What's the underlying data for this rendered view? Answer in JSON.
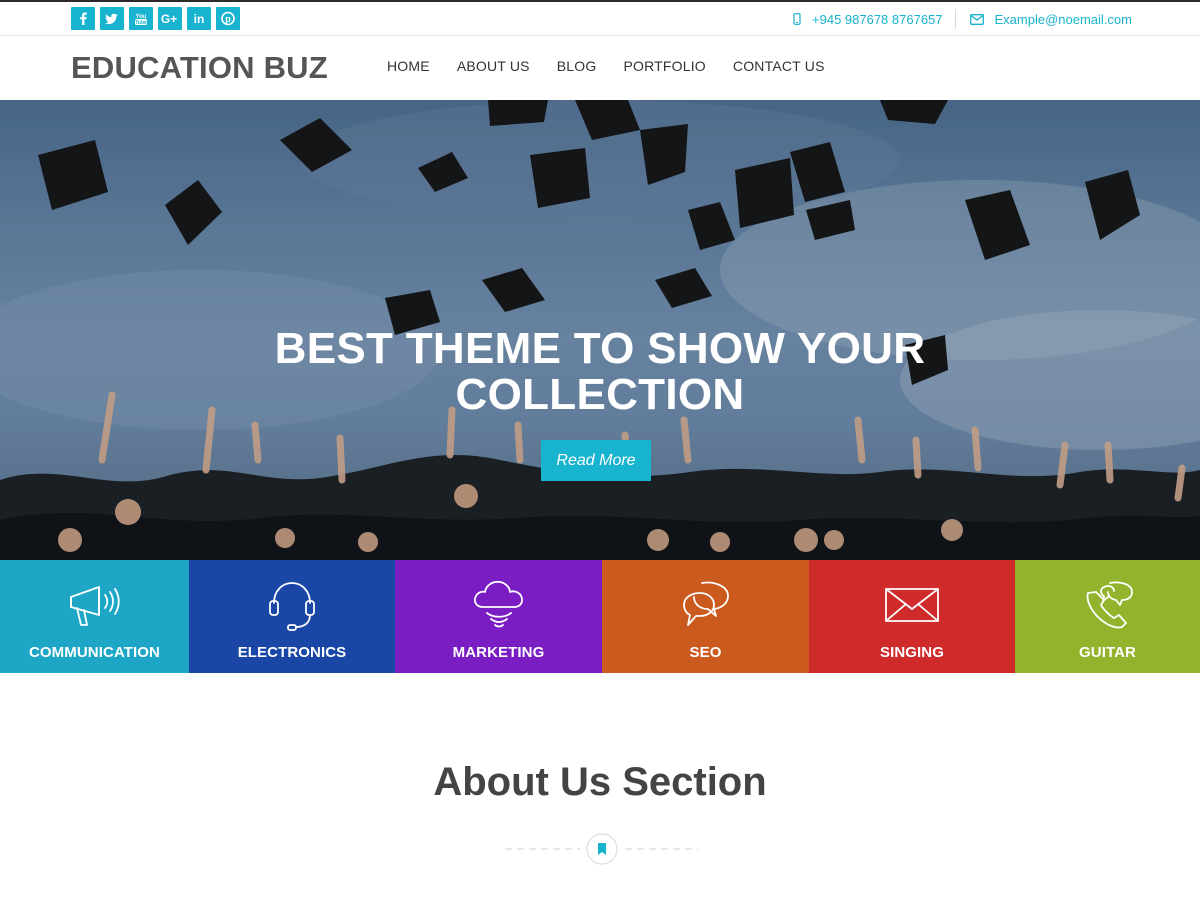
{
  "social": {
    "icons": [
      "facebook-icon",
      "twitter-icon",
      "youtube-icon",
      "google-plus-icon",
      "linkedin-icon",
      "pinterest-icon"
    ],
    "color": "#17b3cf"
  },
  "contact": {
    "phone": "+945 987678 8767657",
    "email": "Example@noemail.com"
  },
  "header": {
    "logo": "EDUCATION BUZ",
    "nav": [
      "HOME",
      "ABOUT US",
      "BLOG",
      "PORTFOLIO",
      "CONTACT US"
    ]
  },
  "hero": {
    "title_line1": "BEST THEME TO SHOW YOUR",
    "title_line2": "COLLECTION",
    "button": "Read More",
    "accent": "#17b3cf"
  },
  "categories": [
    {
      "label": "COMMUNICATION",
      "icon": "megaphone-icon",
      "color": "#1ea6c6"
    },
    {
      "label": "ELECTRONICS",
      "icon": "headset-icon",
      "color": "#1a47a5"
    },
    {
      "label": "MARKETING",
      "icon": "cloud-icon",
      "color": "#7a1ec4"
    },
    {
      "label": "SEO",
      "icon": "chat-bubbles-icon",
      "color": "#cb5a1e"
    },
    {
      "label": "SINGING",
      "icon": "envelope-icon",
      "color": "#cf2b2b"
    },
    {
      "label": "GUITAR",
      "icon": "phone-chat-icon",
      "color": "#93b32c"
    }
  ],
  "about": {
    "title": "About Us Section",
    "divider_icon": "bookmark-icon"
  }
}
